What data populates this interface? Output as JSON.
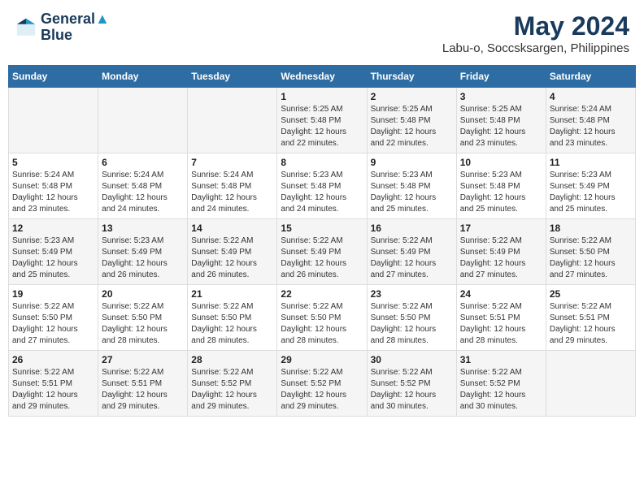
{
  "logo": {
    "line1": "General",
    "line2": "Blue"
  },
  "title": "May 2024",
  "subtitle": "Labu-o, Soccsksargen, Philippines",
  "days_of_week": [
    "Sunday",
    "Monday",
    "Tuesday",
    "Wednesday",
    "Thursday",
    "Friday",
    "Saturday"
  ],
  "weeks": [
    {
      "cells": [
        {
          "day": "",
          "info": ""
        },
        {
          "day": "",
          "info": ""
        },
        {
          "day": "",
          "info": ""
        },
        {
          "day": "1",
          "info": "Sunrise: 5:25 AM\nSunset: 5:48 PM\nDaylight: 12 hours\nand 22 minutes."
        },
        {
          "day": "2",
          "info": "Sunrise: 5:25 AM\nSunset: 5:48 PM\nDaylight: 12 hours\nand 22 minutes."
        },
        {
          "day": "3",
          "info": "Sunrise: 5:25 AM\nSunset: 5:48 PM\nDaylight: 12 hours\nand 23 minutes."
        },
        {
          "day": "4",
          "info": "Sunrise: 5:24 AM\nSunset: 5:48 PM\nDaylight: 12 hours\nand 23 minutes."
        }
      ]
    },
    {
      "cells": [
        {
          "day": "5",
          "info": "Sunrise: 5:24 AM\nSunset: 5:48 PM\nDaylight: 12 hours\nand 23 minutes."
        },
        {
          "day": "6",
          "info": "Sunrise: 5:24 AM\nSunset: 5:48 PM\nDaylight: 12 hours\nand 24 minutes."
        },
        {
          "day": "7",
          "info": "Sunrise: 5:24 AM\nSunset: 5:48 PM\nDaylight: 12 hours\nand 24 minutes."
        },
        {
          "day": "8",
          "info": "Sunrise: 5:23 AM\nSunset: 5:48 PM\nDaylight: 12 hours\nand 24 minutes."
        },
        {
          "day": "9",
          "info": "Sunrise: 5:23 AM\nSunset: 5:48 PM\nDaylight: 12 hours\nand 25 minutes."
        },
        {
          "day": "10",
          "info": "Sunrise: 5:23 AM\nSunset: 5:48 PM\nDaylight: 12 hours\nand 25 minutes."
        },
        {
          "day": "11",
          "info": "Sunrise: 5:23 AM\nSunset: 5:49 PM\nDaylight: 12 hours\nand 25 minutes."
        }
      ]
    },
    {
      "cells": [
        {
          "day": "12",
          "info": "Sunrise: 5:23 AM\nSunset: 5:49 PM\nDaylight: 12 hours\nand 25 minutes."
        },
        {
          "day": "13",
          "info": "Sunrise: 5:23 AM\nSunset: 5:49 PM\nDaylight: 12 hours\nand 26 minutes."
        },
        {
          "day": "14",
          "info": "Sunrise: 5:22 AM\nSunset: 5:49 PM\nDaylight: 12 hours\nand 26 minutes."
        },
        {
          "day": "15",
          "info": "Sunrise: 5:22 AM\nSunset: 5:49 PM\nDaylight: 12 hours\nand 26 minutes."
        },
        {
          "day": "16",
          "info": "Sunrise: 5:22 AM\nSunset: 5:49 PM\nDaylight: 12 hours\nand 27 minutes."
        },
        {
          "day": "17",
          "info": "Sunrise: 5:22 AM\nSunset: 5:49 PM\nDaylight: 12 hours\nand 27 minutes."
        },
        {
          "day": "18",
          "info": "Sunrise: 5:22 AM\nSunset: 5:50 PM\nDaylight: 12 hours\nand 27 minutes."
        }
      ]
    },
    {
      "cells": [
        {
          "day": "19",
          "info": "Sunrise: 5:22 AM\nSunset: 5:50 PM\nDaylight: 12 hours\nand 27 minutes."
        },
        {
          "day": "20",
          "info": "Sunrise: 5:22 AM\nSunset: 5:50 PM\nDaylight: 12 hours\nand 28 minutes."
        },
        {
          "day": "21",
          "info": "Sunrise: 5:22 AM\nSunset: 5:50 PM\nDaylight: 12 hours\nand 28 minutes."
        },
        {
          "day": "22",
          "info": "Sunrise: 5:22 AM\nSunset: 5:50 PM\nDaylight: 12 hours\nand 28 minutes."
        },
        {
          "day": "23",
          "info": "Sunrise: 5:22 AM\nSunset: 5:50 PM\nDaylight: 12 hours\nand 28 minutes."
        },
        {
          "day": "24",
          "info": "Sunrise: 5:22 AM\nSunset: 5:51 PM\nDaylight: 12 hours\nand 28 minutes."
        },
        {
          "day": "25",
          "info": "Sunrise: 5:22 AM\nSunset: 5:51 PM\nDaylight: 12 hours\nand 29 minutes."
        }
      ]
    },
    {
      "cells": [
        {
          "day": "26",
          "info": "Sunrise: 5:22 AM\nSunset: 5:51 PM\nDaylight: 12 hours\nand 29 minutes."
        },
        {
          "day": "27",
          "info": "Sunrise: 5:22 AM\nSunset: 5:51 PM\nDaylight: 12 hours\nand 29 minutes."
        },
        {
          "day": "28",
          "info": "Sunrise: 5:22 AM\nSunset: 5:52 PM\nDaylight: 12 hours\nand 29 minutes."
        },
        {
          "day": "29",
          "info": "Sunrise: 5:22 AM\nSunset: 5:52 PM\nDaylight: 12 hours\nand 29 minutes."
        },
        {
          "day": "30",
          "info": "Sunrise: 5:22 AM\nSunset: 5:52 PM\nDaylight: 12 hours\nand 30 minutes."
        },
        {
          "day": "31",
          "info": "Sunrise: 5:22 AM\nSunset: 5:52 PM\nDaylight: 12 hours\nand 30 minutes."
        },
        {
          "day": "",
          "info": ""
        }
      ]
    }
  ]
}
